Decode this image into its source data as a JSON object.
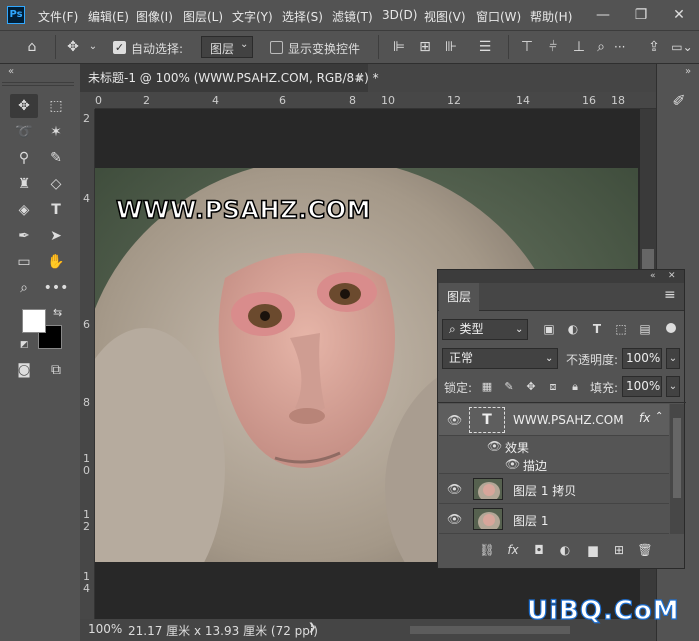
{
  "app": {
    "logo": "Ps"
  },
  "menu": [
    "文件(F)",
    "编辑(E)",
    "图像(I)",
    "图层(L)",
    "文字(Y)",
    "选择(S)",
    "滤镜(T)",
    "3D(D)",
    "视图(V)",
    "窗口(W)",
    "帮助(H)"
  ],
  "window_controls": {
    "minimize": "—",
    "restore": "❐",
    "close": "✕"
  },
  "options": {
    "auto_select_label": "自动选择:",
    "auto_select_target": "图层",
    "show_transform_label": "显示变换控件",
    "more": "···"
  },
  "document": {
    "tab_title": "未标题-1 @ 100% (WWW.PSAHZ.COM, RGB/8#) *",
    "close": "×",
    "overlay_text": "WWW.PSAHZ.COM"
  },
  "ruler": {
    "top": [
      "0",
      "2",
      "4",
      "6",
      "8",
      "10",
      "12",
      "14",
      "16",
      "18"
    ],
    "left": [
      [
        "2"
      ],
      [
        "4"
      ],
      [
        "6"
      ],
      [
        "8"
      ],
      [
        "1",
        "0"
      ],
      [
        "1",
        "2"
      ],
      [
        "1",
        "4"
      ]
    ]
  },
  "status": {
    "zoom": "100%",
    "doc_size": "21.17 厘米 x 13.93 厘米 (72 ppi)"
  },
  "layers_panel": {
    "tab": "图层",
    "filter_kind": "类型",
    "blend_mode": "正常",
    "opacity_label": "不透明度:",
    "opacity_value": "100%",
    "lock_label": "锁定:",
    "fill_label": "填充:",
    "fill_value": "100%",
    "layers": [
      {
        "name": "WWW.PSAHZ.COM",
        "type": "text",
        "fx": "fx"
      },
      {
        "name": "图层 1 拷贝",
        "type": "image"
      },
      {
        "name": "图层 1",
        "type": "image"
      }
    ],
    "effects_label": "效果",
    "stroke_label": "描边",
    "thumb_text": "T"
  },
  "watermark": "UiBQ.CoM"
}
